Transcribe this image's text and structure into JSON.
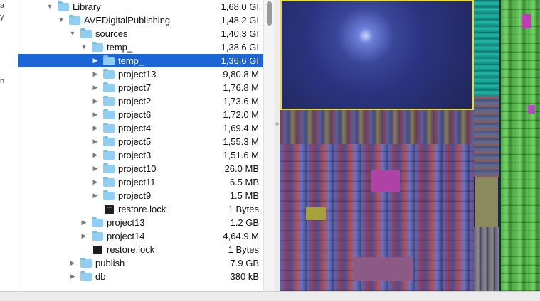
{
  "left_strip": {
    "fragments": [
      "a",
      "y",
      "n"
    ]
  },
  "tree": {
    "rows": [
      {
        "name": "Library",
        "size": "1,68.0 GI",
        "expanded": true,
        "icon": "folder-icon"
      },
      {
        "name": "AVEDigitalPublishing",
        "size": "1,48.2 GI",
        "expanded": true,
        "icon": "folder-icon"
      },
      {
        "name": "sources",
        "size": "1,40.3 GI",
        "expanded": true,
        "icon": "folder-icon"
      },
      {
        "name": "temp_",
        "size": "1,38.6 GI",
        "expanded": true,
        "icon": "folder-icon"
      },
      {
        "name": "temp_",
        "size": "1,36.6 GI",
        "expanded": false,
        "icon": "folder-icon",
        "selected": true
      },
      {
        "name": "project13",
        "size": "9,80.8 M",
        "expanded": false,
        "icon": "folder-icon"
      },
      {
        "name": "project7",
        "size": "1,76.8 M",
        "expanded": false,
        "icon": "folder-icon"
      },
      {
        "name": "project2",
        "size": "1,73.6 M",
        "expanded": false,
        "icon": "folder-icon"
      },
      {
        "name": "project6",
        "size": "1,72.0 M",
        "expanded": false,
        "icon": "folder-icon"
      },
      {
        "name": "project4",
        "size": "1,69.4 M",
        "expanded": false,
        "icon": "folder-icon"
      },
      {
        "name": "project5",
        "size": "1,55.3 M",
        "expanded": false,
        "icon": "folder-icon"
      },
      {
        "name": "project3",
        "size": "1,51.6 M",
        "expanded": false,
        "icon": "folder-icon"
      },
      {
        "name": "project10",
        "size": "26.0 MB",
        "expanded": false,
        "icon": "folder-icon"
      },
      {
        "name": "project11",
        "size": "6.5 MB",
        "expanded": false,
        "icon": "folder-icon"
      },
      {
        "name": "project9",
        "size": "1.5 MB",
        "expanded": false,
        "icon": "folder-icon"
      },
      {
        "name": "restore.lock",
        "size": "1 Bytes",
        "icon": "file-icon"
      },
      {
        "name": "project13",
        "size": "1.2 GB",
        "expanded": false,
        "icon": "folder-icon"
      },
      {
        "name": "project14",
        "size": "4,64.9 M",
        "expanded": false,
        "icon": "folder-icon"
      },
      {
        "name": "restore.lock",
        "size": "1 Bytes",
        "icon": "file-icon"
      },
      {
        "name": "publish",
        "size": "7.9 GB",
        "expanded": false,
        "icon": "folder-icon"
      },
      {
        "name": "db",
        "size": "380 kB",
        "expanded": false,
        "icon": "folder-icon"
      }
    ]
  },
  "colors": {
    "selection": "#1b65d6",
    "folder": "#8fcff4",
    "treemap_highlight": "#e8dc3a"
  }
}
